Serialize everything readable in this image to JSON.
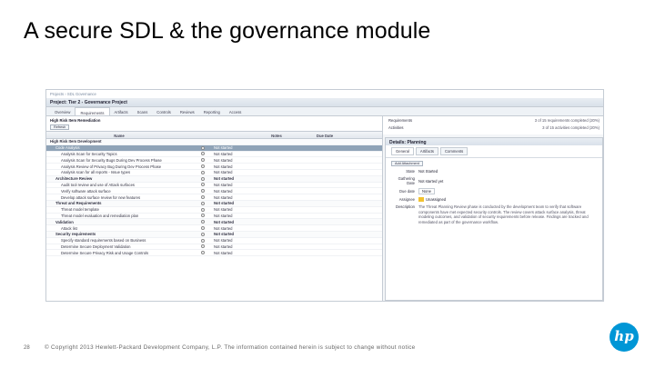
{
  "slide": {
    "title": "A secure SDL & the governance module",
    "page_number": "28",
    "footer": "© Copyright 2013 Hewlett-Packard Development Company, L.P. The information contained herein is subject to change without notice",
    "logo_text": "hp"
  },
  "app": {
    "breadcrumb": "Projects › SDL Governance",
    "project_title": "Project: Tier 2 - Governance Project",
    "tabs": [
      "Overview",
      "Requirements",
      "Artifacts",
      "Scans",
      "Controls",
      "Reviews",
      "Reporting",
      "Access"
    ],
    "active_tab": 1,
    "pane_title": "High Risk Item Remediation",
    "toolbar": {
      "refresh": "Refresh"
    },
    "columns": [
      "Name",
      "State",
      "Notes",
      "Due Date"
    ],
    "rows": [
      {
        "name": "High Risk Item Development",
        "type": "group",
        "status": "",
        "indent": 0
      },
      {
        "name": "Code Analysis",
        "type": "sel",
        "status": "Not started",
        "indent": 1
      },
      {
        "name": "Analysis Scan for Security Topics",
        "type": "item",
        "status": "Not started",
        "indent": 2
      },
      {
        "name": "Analysis Scan for Security Bugs During Dev Process Phase",
        "type": "item",
        "status": "Not started",
        "indent": 2
      },
      {
        "name": "Analysis Review of Privacy Bug During Dev Process Phase",
        "type": "item",
        "status": "Not started",
        "indent": 2
      },
      {
        "name": "Analysis scan for all reports - Issue types",
        "type": "item",
        "status": "Not started",
        "indent": 2
      },
      {
        "name": "Architecture Review",
        "type": "group",
        "status": "Not started",
        "indent": 1
      },
      {
        "name": "Audit tool review and use of Attack surfaces",
        "type": "item",
        "status": "Not started",
        "indent": 2
      },
      {
        "name": "Verify software attack surface",
        "type": "item",
        "status": "Not started",
        "indent": 2
      },
      {
        "name": "Develop attack surface review for new features",
        "type": "item",
        "status": "Not started",
        "indent": 2
      },
      {
        "name": "Threat and Requirements",
        "type": "group",
        "status": "Not started",
        "indent": 1
      },
      {
        "name": "Threat model template",
        "type": "item",
        "status": "Not started",
        "indent": 2
      },
      {
        "name": "Threat model evaluation and remediation plan",
        "type": "item",
        "status": "Not started",
        "indent": 2
      },
      {
        "name": "Validation",
        "type": "group",
        "status": "Not started",
        "indent": 1
      },
      {
        "name": "Attack list",
        "type": "item",
        "status": "Not started",
        "indent": 2
      },
      {
        "name": "Security requirements",
        "type": "group",
        "status": "Not started",
        "indent": 1
      },
      {
        "name": "Specify standard requirements based on Business",
        "type": "item",
        "status": "Not started",
        "indent": 2
      },
      {
        "name": "Determine Secure Deployment Validation",
        "type": "item",
        "status": "Not started",
        "indent": 2
      },
      {
        "name": "Determine Secure Privacy Risk and Usage Controls",
        "type": "item",
        "status": "Not started",
        "indent": 2
      }
    ],
    "summary": [
      {
        "label": "Requirements",
        "value": "3 of 15 requirements completed (20%)"
      },
      {
        "label": "Activities",
        "value": "3 of 15 activities completed (20%)"
      }
    ],
    "detail": {
      "title": "Details: Planning",
      "tabs": [
        "General",
        "Artifacts",
        "Comments"
      ],
      "add_button": "Add Attachment",
      "fields": [
        {
          "key": "State",
          "value": "Not Started"
        },
        {
          "key": "Gathering Date",
          "value": "Not started yet"
        },
        {
          "key": "Due date",
          "value": "None"
        },
        {
          "key": "Assignee",
          "value": "Unassigned"
        }
      ],
      "description_label": "Description",
      "description": "The Threat Planning Review phase is conducted by the development team to verify that software components have met expected security controls. The review covers attack surface analysis, threat modeling outcomes, and validation of security requirements before release. Findings are tracked and remediated as part of the governance workflow."
    }
  }
}
